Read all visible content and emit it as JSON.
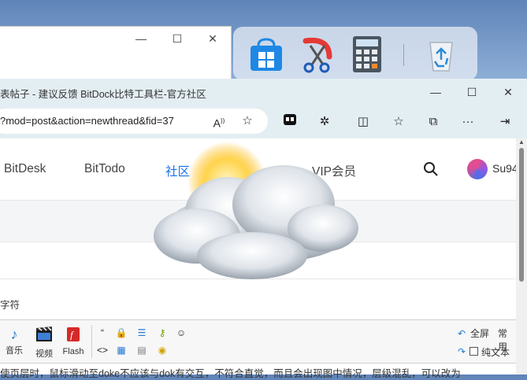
{
  "background_window": {
    "controls": [
      "—",
      "☐",
      "✕"
    ]
  },
  "dock": {
    "icons": [
      "store-icon",
      "scissors-icon",
      "calculator-icon",
      "recycle-bin-icon"
    ]
  },
  "browser": {
    "tab_title": "表帖子 - 建议反馈 BitDock比特工具栏-官方社区",
    "url": "?mod=post&action=newthread&fid=37",
    "window_controls": [
      "—",
      "☐",
      "✕"
    ]
  },
  "site_nav": {
    "items": [
      "BitDesk",
      "BitTodo",
      "社区",
      "VIP会员"
    ],
    "active_index": 2,
    "user": "Su94",
    "accent": "#1a73e8"
  },
  "form": {
    "hint": "字符"
  },
  "editor": {
    "items": [
      {
        "label": "音乐",
        "icon": "music-icon"
      },
      {
        "label": "视频",
        "icon": "video-icon"
      },
      {
        "label": "Flash",
        "icon": "flash-icon"
      }
    ],
    "fullscreen": "全屏",
    "common": "常用",
    "plain_text": "纯文本",
    "plain_text_checked": false
  },
  "body_text": "使页层时，鼠标滑动至doke不应该与dok有交互，不符合直觉，而且会出现图中情况，层级混乱，可以改为"
}
